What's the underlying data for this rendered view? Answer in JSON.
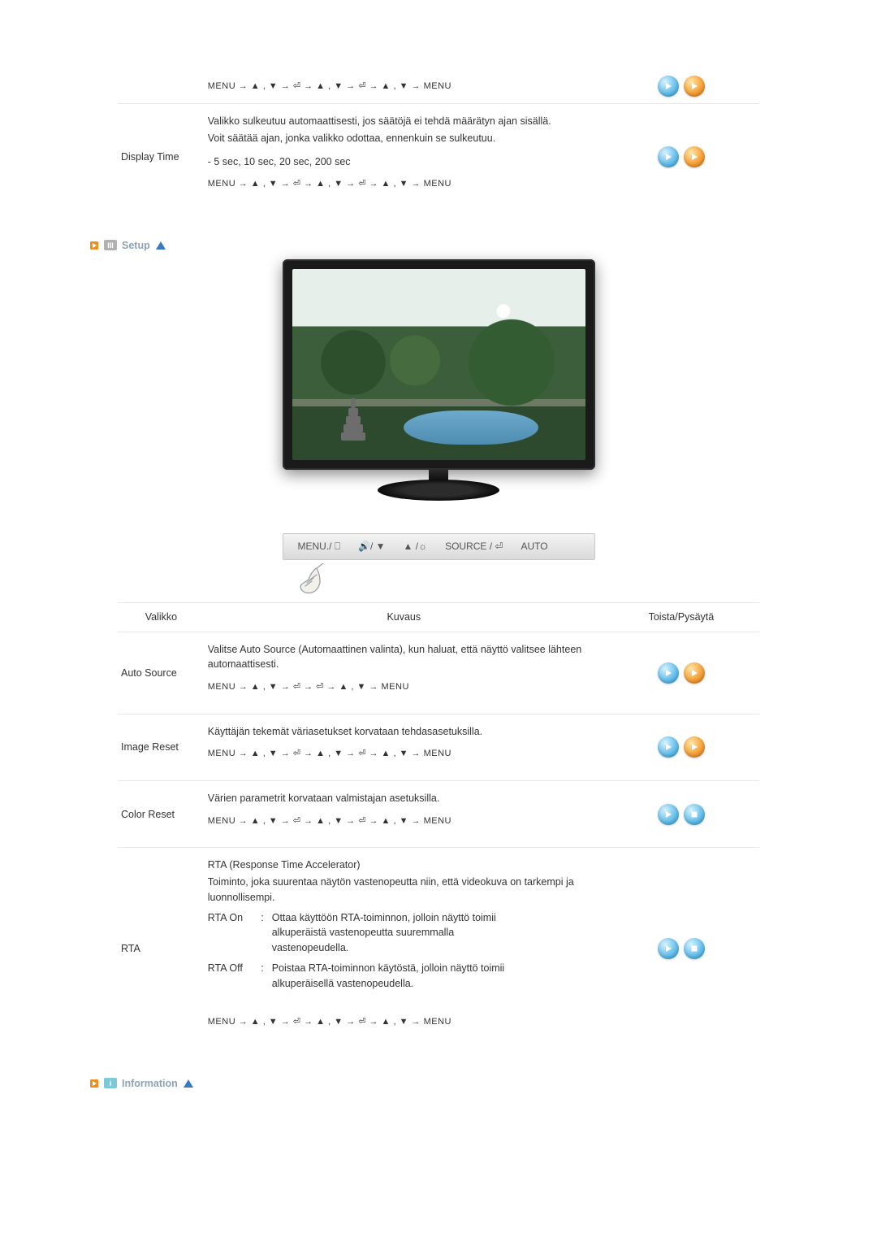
{
  "sections": {
    "setup_heading": "Setup",
    "information_heading": "Information"
  },
  "top_rows": {
    "row1_nav": "MENU → ▲ , ▼ → ⏎ → ▲ , ▼ → ⏎ → ▲ , ▼ → MENU",
    "display_time": {
      "label": "Display Time",
      "p1": "Valikko sulkeutuu automaattisesti, jos säätöjä ei tehdä määrätyn ajan sisällä.",
      "p2": "Voit säätää ajan, jonka valikko odottaa, ennenkuin se sulkeutuu.",
      "options": "- 5 sec, 10 sec, 20 sec, 200 sec",
      "nav": "MENU → ▲ , ▼ → ⏎ → ▲ , ▼ → ⏎ → ▲ , ▼ → MENU"
    }
  },
  "button_bar": {
    "b1": "MENU./ ⎕",
    "b2": "🔊/ ▼",
    "b3": "▲ /☼",
    "b4": "SOURCE / ⏎",
    "b5": "AUTO"
  },
  "table": {
    "headers": {
      "menu": "Valikko",
      "desc": "Kuvaus",
      "play": "Toista/Pysäytä"
    },
    "auto_source": {
      "label": "Auto Source",
      "desc": "Valitse Auto Source (Automaattinen valinta), kun haluat, että näyttö valitsee lähteen automaattisesti.",
      "nav": "MENU → ▲ , ▼ → ⏎ → ⏎ → ▲ , ▼ → MENU"
    },
    "image_reset": {
      "label": "Image Reset",
      "desc": "Käyttäjän tekemät väriasetukset korvataan tehdasasetuksilla.",
      "nav": "MENU → ▲ , ▼ → ⏎ → ▲ , ▼ → ⏎ → ▲ , ▼ → MENU"
    },
    "color_reset": {
      "label": "Color Reset",
      "desc": "Värien parametrit korvataan valmistajan asetuksilla.",
      "nav": "MENU → ▲ , ▼ → ⏎ → ▲ , ▼ → ⏎ → ▲ , ▼ → MENU"
    },
    "rta": {
      "label": "RTA",
      "title": "RTA (Response Time Accelerator)",
      "intro": "Toiminto, joka suurentaa näytön vastenopeutta niin, että videokuva on tarkempi ja luonnollisempi.",
      "on_label": "RTA On",
      "on_text": "Ottaa käyttöön RTA-toiminnon, jolloin näyttö toimii alkuperäistä vastenopeutta suuremmalla vastenopeudella.",
      "off_label": "RTA Off",
      "off_text": "Poistaa RTA-toiminnon käytöstä, jolloin näyttö toimii alkuperäisellä vastenopeudella.",
      "nav": "MENU → ▲ , ▼ → ⏎ → ▲ , ▼ → ⏎ → ▲ , ▼ → MENU"
    }
  },
  "icons": {
    "colon": ":"
  }
}
